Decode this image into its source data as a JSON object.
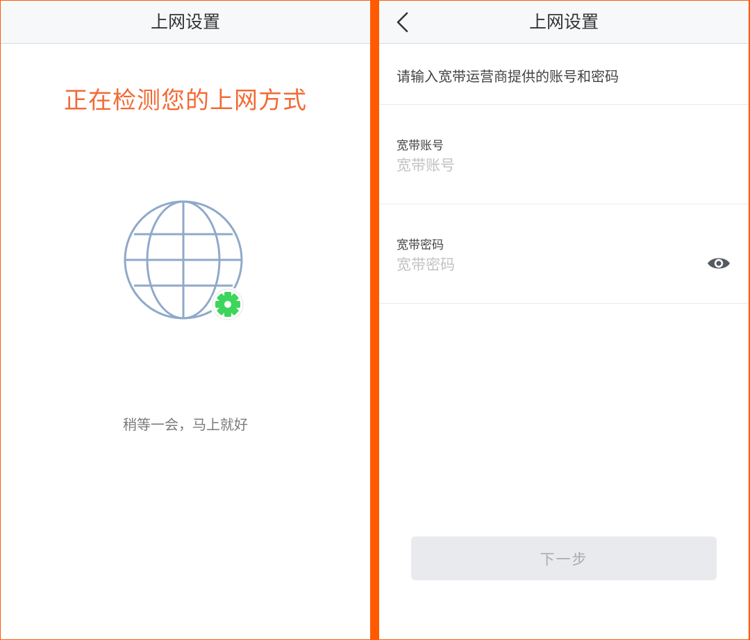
{
  "left_screen": {
    "nav_title": "上网设置",
    "detect_title": "正在检测您的上网方式",
    "wait_text": "稍等一会，马上就好",
    "icons": {
      "globe": "globe-icon",
      "gear": "gear-icon"
    },
    "colors": {
      "title": "#f26a35",
      "globe": "#8fa9c9",
      "gear": "#3dd65c"
    }
  },
  "right_screen": {
    "nav_title": "上网设置",
    "back_icon": "chevron-left-icon",
    "prompt": "请输入宽带运营商提供的账号和密码",
    "account": {
      "label": "宽带账号",
      "placeholder": "宽带账号",
      "value": ""
    },
    "password": {
      "label": "宽带密码",
      "placeholder": "宽带密码",
      "value": "",
      "toggle_icon": "eye-icon"
    },
    "next_label": "下一步"
  },
  "colors": {
    "divider": "#ff5a00",
    "accent": "#f26a35",
    "button_disabled": "#e8eaed"
  }
}
